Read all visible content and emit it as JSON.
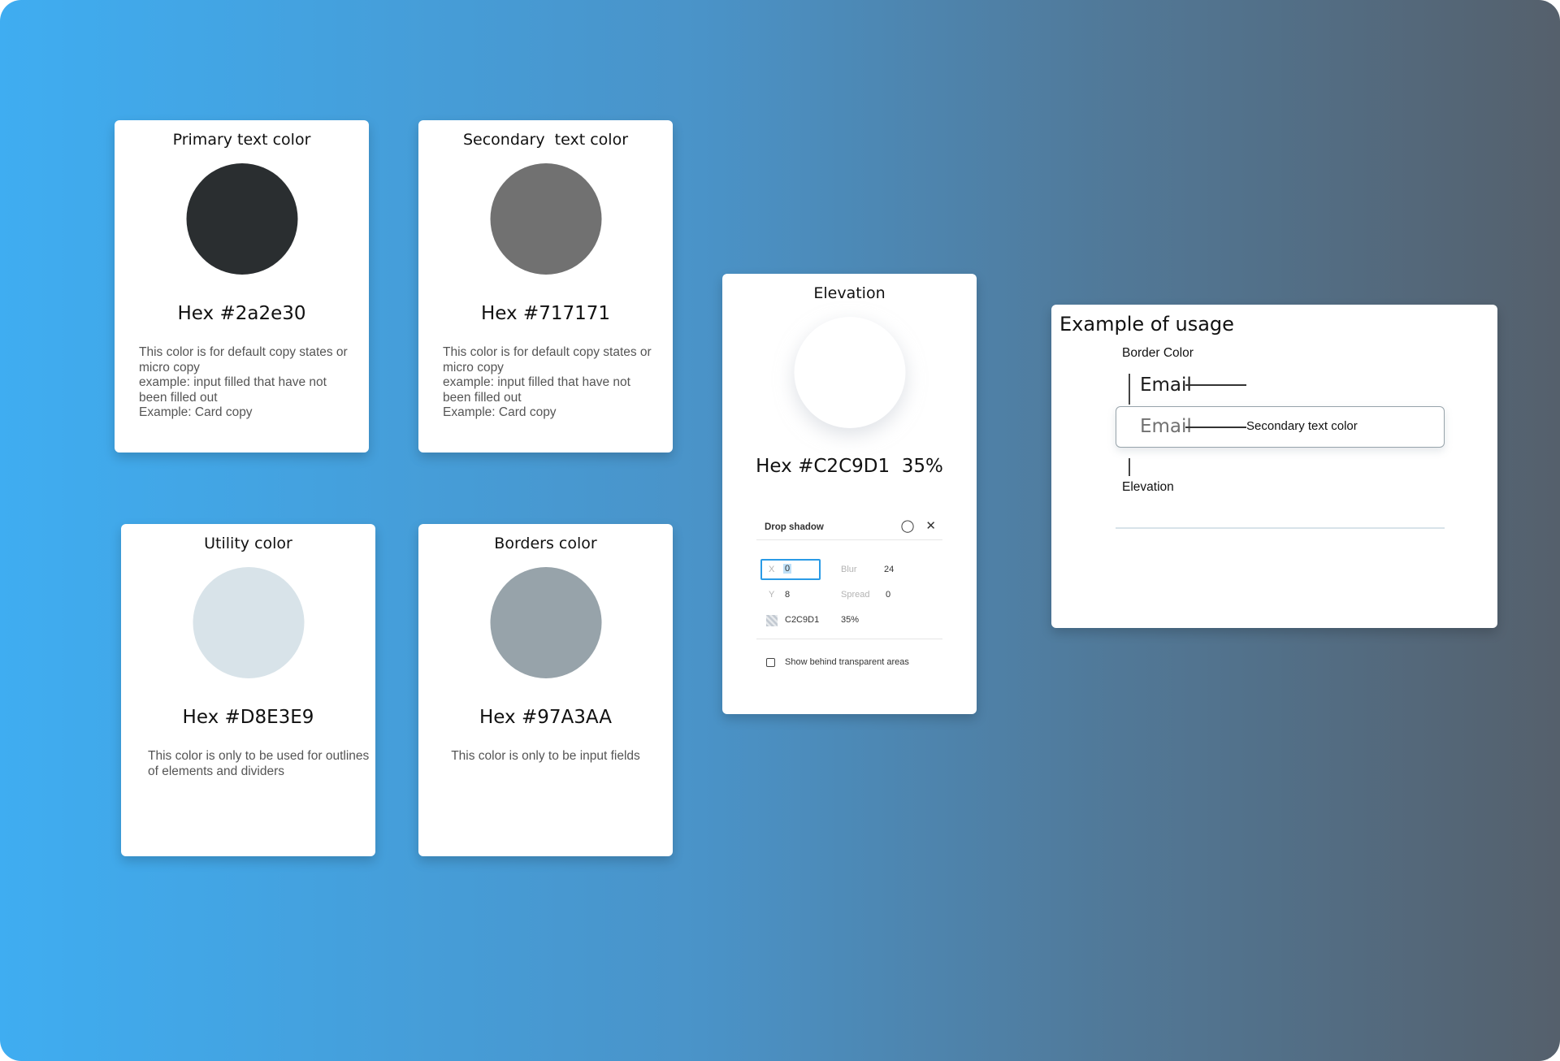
{
  "cards": [
    {
      "title": "Primary text color",
      "hex": "Hex #2a2e30",
      "color": "#2a2e30",
      "lines": [
        "This color is for default copy states or",
        "micro copy",
        "example: input filled that have not",
        "been filled out",
        "Example: Card copy"
      ]
    },
    {
      "title": "Secondary  text color",
      "hex": "Hex #717171",
      "color": "#717171",
      "lines": [
        "This color is for default copy states or",
        "micro copy",
        "example: input filled that have not",
        "been filled out",
        "Example: Card copy"
      ]
    },
    {
      "title": "Utility color",
      "hex": "Hex #D8E3E9",
      "color": "#D8E3E9",
      "lines": [
        "This color is only to be used for outlines",
        "of elements and dividers"
      ]
    },
    {
      "title": "Borders color",
      "hex": "Hex #97A3AA",
      "color": "#97A3AA",
      "lines": [
        "This color is only to be input fields"
      ]
    }
  ],
  "elevation": {
    "title": "Elevation",
    "hex": "Hex #C2C9D1  35%",
    "panel": {
      "heading": "Drop shadow",
      "icons": [
        "droplet-icon",
        "close-icon"
      ],
      "x_label": "X",
      "x_value": "0",
      "blur_label": "Blur",
      "blur_value": "24",
      "y_label": "Y",
      "y_value": "8",
      "spread_label": "Spread",
      "spread_value": "0",
      "color_value": "C2C9D1",
      "opacity_value": "35%",
      "checkbox_label": "Show behind transparent areas",
      "checkbox_checked": false
    }
  },
  "usage": {
    "title": "Example of usage",
    "border_label": "Border Color",
    "email_label": "Email",
    "email_placeholder": "Email",
    "secondary_label": "Secondary text color",
    "elevation_label": "Elevation"
  }
}
